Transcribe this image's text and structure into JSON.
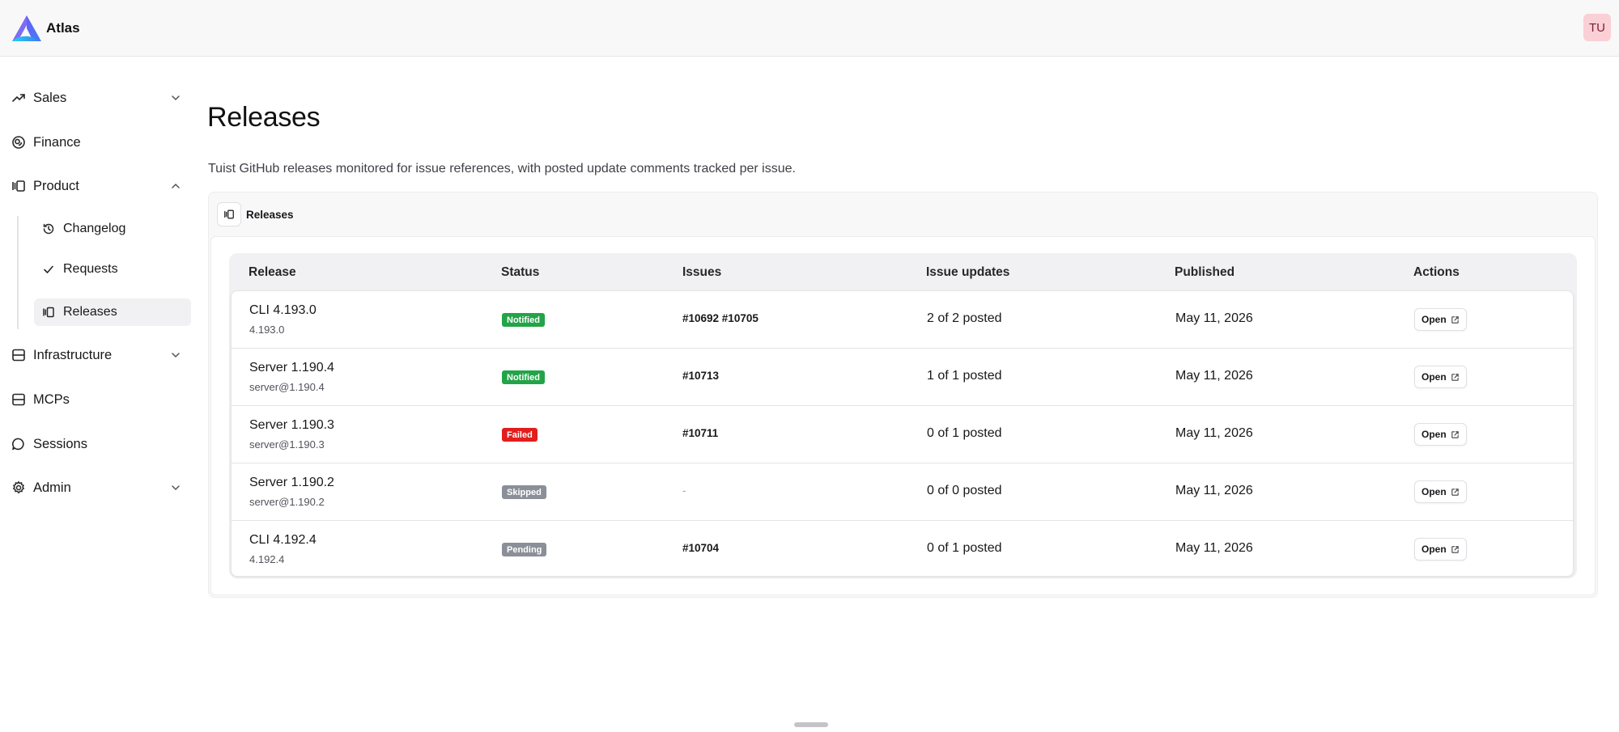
{
  "app": {
    "brand": "Atlas",
    "avatar_initials": "TU"
  },
  "sidebar": {
    "items": [
      {
        "label": "Sales",
        "icon": "trending-up-icon",
        "expandable": true,
        "expanded": false
      },
      {
        "label": "Finance",
        "icon": "coins-icon",
        "expandable": false
      },
      {
        "label": "Product",
        "icon": "panel-icon",
        "expandable": true,
        "expanded": true
      },
      {
        "label": "Infrastructure",
        "icon": "server-icon",
        "expandable": true,
        "expanded": false
      },
      {
        "label": "MCPs",
        "icon": "server-icon",
        "expandable": false
      },
      {
        "label": "Sessions",
        "icon": "chat-bubble-icon",
        "expandable": false
      },
      {
        "label": "Admin",
        "icon": "gear-icon",
        "expandable": true,
        "expanded": false
      }
    ],
    "product_children": [
      {
        "label": "Changelog",
        "icon": "history-icon"
      },
      {
        "label": "Requests",
        "icon": "check-icon"
      },
      {
        "label": "Releases",
        "icon": "panel-icon",
        "active": true
      }
    ]
  },
  "page": {
    "title": "Releases",
    "description": "Tuist GitHub releases monitored for issue references, with posted update comments tracked per issue.",
    "card_tab": "Releases"
  },
  "table": {
    "columns": [
      "Release",
      "Status",
      "Issues",
      "Issue updates",
      "Published",
      "Actions"
    ],
    "rows": [
      {
        "name": "CLI 4.193.0",
        "tag": "4.193.0",
        "status": "Notified",
        "issues": "#10692 #10705",
        "updates": "2 of 2 posted",
        "published": "May 11, 2026",
        "action": "Open"
      },
      {
        "name": "Server 1.190.4",
        "tag": "server@1.190.4",
        "status": "Notified",
        "issues": "#10713",
        "updates": "1 of 1 posted",
        "published": "May 11, 2026",
        "action": "Open"
      },
      {
        "name": "Server 1.190.3",
        "tag": "server@1.190.3",
        "status": "Failed",
        "issues": "#10711",
        "updates": "0 of 1 posted",
        "published": "May 11, 2026",
        "action": "Open"
      },
      {
        "name": "Server 1.190.2",
        "tag": "server@1.190.2",
        "status": "Skipped",
        "issues": "-",
        "updates": "0 of 0 posted",
        "published": "May 11, 2026",
        "action": "Open"
      },
      {
        "name": "CLI 4.192.4",
        "tag": "4.192.4",
        "status": "Pending",
        "issues": "#10704",
        "updates": "0 of 1 posted",
        "published": "May 11, 2026",
        "action": "Open"
      }
    ]
  },
  "colors": {
    "notified": "#22a447",
    "failed": "#e11d1d",
    "skipped": "#8a8f98",
    "pending": "#8a8f98",
    "active_nav_bg": "#f1f1f3"
  }
}
